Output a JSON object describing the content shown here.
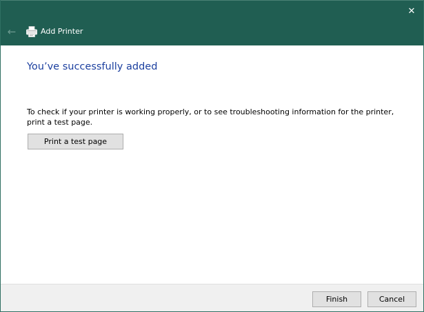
{
  "window": {
    "title": "Add Printer",
    "close_glyph": "✕",
    "back_glyph": "←",
    "icons": {
      "back": "back-arrow-icon",
      "printer": "printer-icon",
      "close": "close-icon"
    }
  },
  "content": {
    "heading": "You’ve successfully added",
    "description": "To check if your printer is working properly, or to see troubleshooting information for the printer, print a test page.",
    "test_button_label": "Print a test page"
  },
  "footer": {
    "finish_label": "Finish",
    "cancel_label": "Cancel"
  },
  "colors": {
    "titlebar": "#205e52",
    "heading": "#1b3f9f",
    "button_face": "#e1e1e1",
    "footer": "#f0f0f0"
  }
}
